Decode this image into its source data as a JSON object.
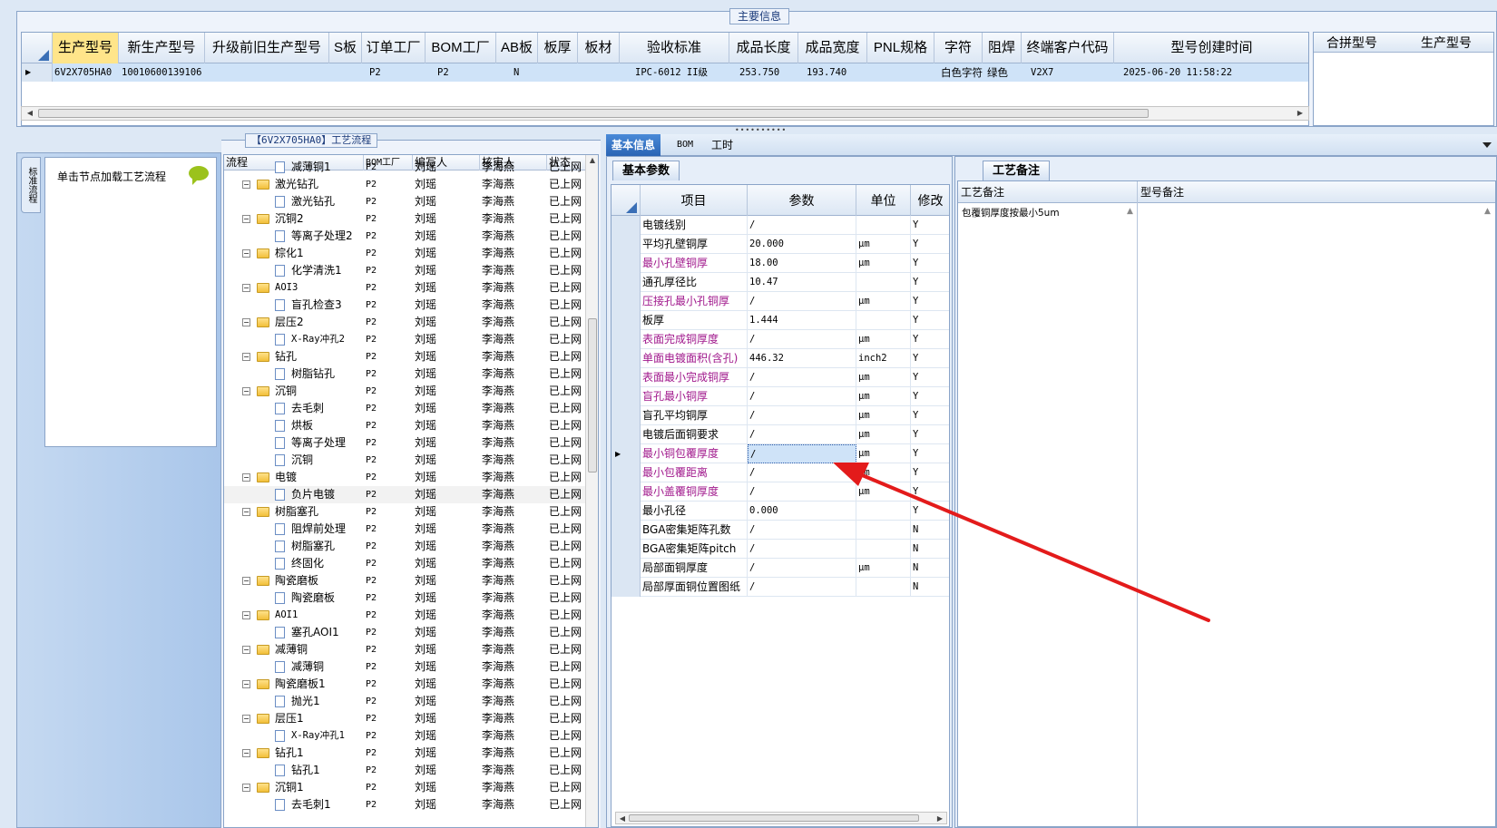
{
  "top": {
    "title": "主要信息",
    "columns": [
      "生产型号",
      "新生产型号",
      "升级前旧生产型号",
      "S板",
      "订单工厂",
      "BOM工厂",
      "AB板",
      "板厚",
      "板材",
      "验收标准",
      "成品长度",
      "成品宽度",
      "PNL规格",
      "字符",
      "阻焊",
      "终端客户代码",
      "型号创建时间"
    ],
    "row": {
      "marker": "▶",
      "prod_model": "6V2X705HA0",
      "new_model": "10010600139106",
      "order_factory": "P2",
      "bom_factory": "P2",
      "ab": "N",
      "standard": "IPC-6012 II级",
      "length": "253.750",
      "width": "193.740",
      "char": "白色字符",
      "mask": "绿色",
      "customer": "V2X7",
      "created": "2025-06-20 11:58:22"
    },
    "merge_headers": [
      "合拼型号",
      "生产型号"
    ]
  },
  "left": {
    "vtab": "标准流程",
    "hint": "单击节点加载工艺流程"
  },
  "process": {
    "title": "【6V2X705HA0】工艺流程",
    "headers": [
      "流程",
      "BOM工厂",
      "编写人",
      "核审人",
      "状态"
    ],
    "rows": [
      {
        "name": "减薄铜1",
        "lvl": 2,
        "bom": "P2",
        "writer": "刘瑶",
        "reviewer": "李海燕",
        "status": "已上网"
      },
      {
        "name": "激光钻孔",
        "lvl": 1,
        "bom": "P2",
        "writer": "刘瑶",
        "reviewer": "李海燕",
        "status": "已上网"
      },
      {
        "name": "激光钻孔",
        "lvl": 2,
        "bom": "P2",
        "writer": "刘瑶",
        "reviewer": "李海燕",
        "status": "已上网"
      },
      {
        "name": "沉铜2",
        "lvl": 1,
        "bom": "P2",
        "writer": "刘瑶",
        "reviewer": "李海燕",
        "status": "已上网"
      },
      {
        "name": "等离子处理2",
        "lvl": 2,
        "bom": "P2",
        "writer": "刘瑶",
        "reviewer": "李海燕",
        "status": "已上网"
      },
      {
        "name": "棕化1",
        "lvl": 1,
        "bom": "P2",
        "writer": "刘瑶",
        "reviewer": "李海燕",
        "status": "已上网"
      },
      {
        "name": "化学清洗1",
        "lvl": 2,
        "bom": "P2",
        "writer": "刘瑶",
        "reviewer": "李海燕",
        "status": "已上网"
      },
      {
        "name": "AOI3",
        "lvl": 1,
        "bom": "P2",
        "writer": "刘瑶",
        "reviewer": "李海燕",
        "status": "已上网"
      },
      {
        "name": "盲孔检查3",
        "lvl": 2,
        "bom": "P2",
        "writer": "刘瑶",
        "reviewer": "李海燕",
        "status": "已上网"
      },
      {
        "name": "层压2",
        "lvl": 1,
        "bom": "P2",
        "writer": "刘瑶",
        "reviewer": "李海燕",
        "status": "已上网"
      },
      {
        "name": "X-Ray冲孔2",
        "lvl": 2,
        "bom": "P2",
        "writer": "刘瑶",
        "reviewer": "李海燕",
        "status": "已上网"
      },
      {
        "name": "钻孔",
        "lvl": 1,
        "bom": "P2",
        "writer": "刘瑶",
        "reviewer": "李海燕",
        "status": "已上网"
      },
      {
        "name": "树脂钻孔",
        "lvl": 2,
        "bom": "P2",
        "writer": "刘瑶",
        "reviewer": "李海燕",
        "status": "已上网"
      },
      {
        "name": "沉铜",
        "lvl": 1,
        "bom": "P2",
        "writer": "刘瑶",
        "reviewer": "李海燕",
        "status": "已上网"
      },
      {
        "name": "去毛刺",
        "lvl": 2,
        "bom": "P2",
        "writer": "刘瑶",
        "reviewer": "李海燕",
        "status": "已上网"
      },
      {
        "name": "烘板",
        "lvl": 2,
        "bom": "P2",
        "writer": "刘瑶",
        "reviewer": "李海燕",
        "status": "已上网"
      },
      {
        "name": "等离子处理",
        "lvl": 2,
        "bom": "P2",
        "writer": "刘瑶",
        "reviewer": "李海燕",
        "status": "已上网"
      },
      {
        "name": "沉铜",
        "lvl": 2,
        "bom": "P2",
        "writer": "刘瑶",
        "reviewer": "李海燕",
        "status": "已上网"
      },
      {
        "name": "电镀",
        "lvl": 1,
        "bom": "P2",
        "writer": "刘瑶",
        "reviewer": "李海燕",
        "status": "已上网"
      },
      {
        "name": "负片电镀",
        "lvl": 2,
        "bom": "P2",
        "writer": "刘瑶",
        "reviewer": "李海燕",
        "status": "已上网",
        "sel": true
      },
      {
        "name": "树脂塞孔",
        "lvl": 1,
        "bom": "P2",
        "writer": "刘瑶",
        "reviewer": "李海燕",
        "status": "已上网"
      },
      {
        "name": "阻焊前处理",
        "lvl": 2,
        "bom": "P2",
        "writer": "刘瑶",
        "reviewer": "李海燕",
        "status": "已上网"
      },
      {
        "name": "树脂塞孔",
        "lvl": 2,
        "bom": "P2",
        "writer": "刘瑶",
        "reviewer": "李海燕",
        "status": "已上网"
      },
      {
        "name": "终固化",
        "lvl": 2,
        "bom": "P2",
        "writer": "刘瑶",
        "reviewer": "李海燕",
        "status": "已上网"
      },
      {
        "name": "陶瓷磨板",
        "lvl": 1,
        "bom": "P2",
        "writer": "刘瑶",
        "reviewer": "李海燕",
        "status": "已上网"
      },
      {
        "name": "陶瓷磨板",
        "lvl": 2,
        "bom": "P2",
        "writer": "刘瑶",
        "reviewer": "李海燕",
        "status": "已上网"
      },
      {
        "name": "AOI1",
        "lvl": 1,
        "bom": "P2",
        "writer": "刘瑶",
        "reviewer": "李海燕",
        "status": "已上网"
      },
      {
        "name": "塞孔AOI1",
        "lvl": 2,
        "bom": "P2",
        "writer": "刘瑶",
        "reviewer": "李海燕",
        "status": "已上网"
      },
      {
        "name": "减薄铜",
        "lvl": 1,
        "bom": "P2",
        "writer": "刘瑶",
        "reviewer": "李海燕",
        "status": "已上网"
      },
      {
        "name": "减薄铜",
        "lvl": 2,
        "bom": "P2",
        "writer": "刘瑶",
        "reviewer": "李海燕",
        "status": "已上网"
      },
      {
        "name": "陶瓷磨板1",
        "lvl": 1,
        "bom": "P2",
        "writer": "刘瑶",
        "reviewer": "李海燕",
        "status": "已上网"
      },
      {
        "name": "抛光1",
        "lvl": 2,
        "bom": "P2",
        "writer": "刘瑶",
        "reviewer": "李海燕",
        "status": "已上网"
      },
      {
        "name": "层压1",
        "lvl": 1,
        "bom": "P2",
        "writer": "刘瑶",
        "reviewer": "李海燕",
        "status": "已上网"
      },
      {
        "name": "X-Ray冲孔1",
        "lvl": 2,
        "bom": "P2",
        "writer": "刘瑶",
        "reviewer": "李海燕",
        "status": "已上网"
      },
      {
        "name": "钻孔1",
        "lvl": 1,
        "bom": "P2",
        "writer": "刘瑶",
        "reviewer": "李海燕",
        "status": "已上网"
      },
      {
        "name": "钻孔1",
        "lvl": 2,
        "bom": "P2",
        "writer": "刘瑶",
        "reviewer": "李海燕",
        "status": "已上网"
      },
      {
        "name": "沉铜1",
        "lvl": 1,
        "bom": "P2",
        "writer": "刘瑶",
        "reviewer": "李海燕",
        "status": "已上网"
      },
      {
        "name": "去毛刺1",
        "lvl": 2,
        "bom": "P2",
        "writer": "刘瑶",
        "reviewer": "李海燕",
        "status": "已上网"
      }
    ]
  },
  "tabs": [
    "基本信息",
    "BOM",
    "工时"
  ],
  "basic": {
    "subtab": "基本参数",
    "headers": [
      "项目",
      "参数",
      "单位",
      "修改"
    ],
    "rows": [
      {
        "item": "电镀线别",
        "param": "/",
        "unit": "",
        "mod": "Y",
        "red": false
      },
      {
        "item": "平均孔壁铜厚",
        "param": "20.000",
        "unit": "μm",
        "mod": "Y",
        "red": false
      },
      {
        "item": "最小孔壁铜厚",
        "param": "18.00",
        "unit": "μm",
        "mod": "Y",
        "red": true
      },
      {
        "item": "通孔厚径比",
        "param": "10.47",
        "unit": "",
        "mod": "Y",
        "red": false
      },
      {
        "item": "压接孔最小孔铜厚",
        "param": "/",
        "unit": "μm",
        "mod": "Y",
        "red": true
      },
      {
        "item": "板厚",
        "param": "1.444",
        "unit": "",
        "mod": "Y",
        "red": false
      },
      {
        "item": "表面完成铜厚度",
        "param": "/",
        "unit": "μm",
        "mod": "Y",
        "red": true
      },
      {
        "item": "单面电镀面积(含孔)",
        "param": "446.32",
        "unit": "inch2",
        "mod": "Y",
        "red": true
      },
      {
        "item": "表面最小完成铜厚",
        "param": "/",
        "unit": "μm",
        "mod": "Y",
        "red": true
      },
      {
        "item": "盲孔最小铜厚",
        "param": "/",
        "unit": "μm",
        "mod": "Y",
        "red": true
      },
      {
        "item": "盲孔平均铜厚",
        "param": "/",
        "unit": "μm",
        "mod": "Y",
        "red": false
      },
      {
        "item": "电镀后面铜要求",
        "param": "/",
        "unit": "μm",
        "mod": "Y",
        "red": false
      },
      {
        "item": "最小铜包覆厚度",
        "param": "/",
        "unit": "μm",
        "mod": "Y",
        "red": true,
        "sel": true
      },
      {
        "item": "最小包覆距离",
        "param": "/",
        "unit": "μm",
        "mod": "Y",
        "red": true
      },
      {
        "item": "最小盖覆铜厚度",
        "param": "/",
        "unit": "μm",
        "mod": "Y",
        "red": true
      },
      {
        "item": "最小孔径",
        "param": "0.000",
        "unit": "",
        "mod": "Y",
        "red": false
      },
      {
        "item": "BGA密集矩阵孔数",
        "param": "/",
        "unit": "",
        "mod": "N",
        "red": false
      },
      {
        "item": "BGA密集矩阵pitch",
        "param": "/",
        "unit": "",
        "mod": "N",
        "red": false
      },
      {
        "item": "局部面铜厚度",
        "param": "/",
        "unit": "μm",
        "mod": "N",
        "red": false
      },
      {
        "item": "局部厚面铜位置图纸",
        "param": "/",
        "unit": "",
        "mod": "N",
        "red": false
      }
    ]
  },
  "remarks": {
    "subtab": "工艺备注",
    "headers": [
      "工艺备注",
      "型号备注"
    ],
    "note": "包覆铜厚度按最小5um"
  },
  "colors": {
    "accent": "#2a64b4",
    "highlight": "#ffe58a",
    "selected": "#cfe3f8",
    "magenta": "#a0188c",
    "arrow": "#e31b1b"
  }
}
